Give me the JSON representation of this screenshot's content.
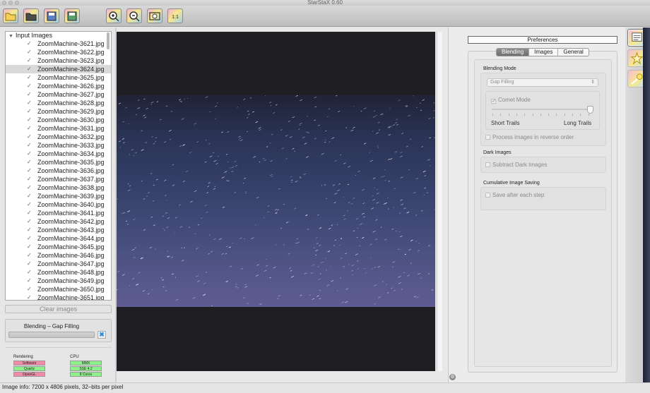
{
  "window": {
    "title": "StarStaX 0.60"
  },
  "toolbar": {
    "buttons": [
      {
        "name": "open-images-button",
        "icon": "folder-open-icon"
      },
      {
        "name": "open-dark-images-button",
        "icon": "folder-dark-icon"
      },
      {
        "name": "save-image-button",
        "icon": "save-icon"
      },
      {
        "name": "save-as-button",
        "icon": "save-as-icon"
      },
      {
        "name": "zoom-in-button",
        "icon": "zoom-in-icon"
      },
      {
        "name": "zoom-out-button",
        "icon": "zoom-out-icon"
      },
      {
        "name": "zoom-fit-button",
        "icon": "zoom-fit-icon"
      },
      {
        "name": "zoom-actual-button",
        "icon": "zoom-actual-icon",
        "label": "1:1"
      }
    ]
  },
  "file_list": {
    "header": "Input Images",
    "selected_index": 3,
    "items": [
      "ZoomMachine-3621.jpg",
      "ZoomMachine-3622.jpg",
      "ZoomMachine-3623.jpg",
      "ZoomMachine-3624.jpg",
      "ZoomMachine-3625.jpg",
      "ZoomMachine-3626.jpg",
      "ZoomMachine-3627.jpg",
      "ZoomMachine-3628.jpg",
      "ZoomMachine-3629.jpg",
      "ZoomMachine-3630.jpg",
      "ZoomMachine-3631.jpg",
      "ZoomMachine-3632.jpg",
      "ZoomMachine-3633.jpg",
      "ZoomMachine-3634.jpg",
      "ZoomMachine-3635.jpg",
      "ZoomMachine-3636.jpg",
      "ZoomMachine-3637.jpg",
      "ZoomMachine-3638.jpg",
      "ZoomMachine-3639.jpg",
      "ZoomMachine-3640.jpg",
      "ZoomMachine-3641.jpg",
      "ZoomMachine-3642.jpg",
      "ZoomMachine-3643.jpg",
      "ZoomMachine-3644.jpg",
      "ZoomMachine-3645.jpg",
      "ZoomMachine-3646.jpg",
      "ZoomMachine-3647.jpg",
      "ZoomMachine-3648.jpg",
      "ZoomMachine-3649.jpg",
      "ZoomMachine-3650.jpg",
      "ZoomMachine-3651.jpg"
    ]
  },
  "clear_button": "Clear images",
  "progress": {
    "label": "Blending – Gap Filling",
    "fraction": 0.0
  },
  "rendering": {
    "header": "Rendering",
    "items": [
      "Software",
      "Quartz",
      "OpenGL"
    ],
    "colors": [
      "#f28aa6",
      "#8ef08a",
      "#f28aa6"
    ]
  },
  "cpu": {
    "header": "CPU",
    "items": [
      "MMX",
      "SSE 4.2",
      "8 Cores"
    ],
    "colors": [
      "#8ef08a",
      "#8ef08a",
      "#8ef08a"
    ]
  },
  "preferences": {
    "title": "Preferences",
    "tabs": [
      "Blending",
      "Images",
      "General"
    ],
    "active_tab": "Blending",
    "blending_mode": {
      "header": "Blending Mode",
      "selected": "Gap Filling"
    },
    "comet_mode": {
      "label": "Comet Mode",
      "checked": true
    },
    "trail_slider": {
      "min_label": "Short Trails",
      "max_label": "Long Trails",
      "value": 1.0
    },
    "reverse_order": {
      "label": "Process images in reverse order",
      "checked": false
    },
    "dark_images": {
      "header": "Dark Images",
      "subtract_label": "Subtract Dark Images",
      "checked": false
    },
    "cumulative": {
      "header": "Cumulative Image Saving",
      "save_label": "Save after each step",
      "checked": false
    }
  },
  "side_buttons": [
    {
      "name": "preferences-panel-button",
      "icon": "preferences-icon",
      "active": true
    },
    {
      "name": "add-panel-button",
      "icon": "star-icon",
      "active": false
    },
    {
      "name": "info-panel-button",
      "icon": "comet-icon",
      "active": false
    }
  ],
  "status": {
    "text": "Image info: 7200 x 4806 pixels, 32–bits per pixel"
  },
  "colors": {
    "selection": "#d9d9d9",
    "tab_active": "#7a7a7a",
    "progress_fill": "#8cc0ea"
  }
}
